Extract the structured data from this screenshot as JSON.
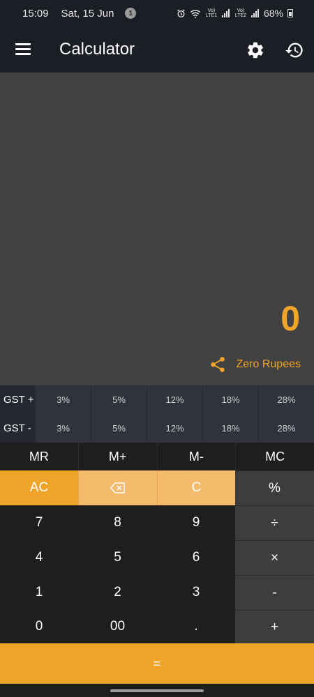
{
  "status_bar": {
    "time": "15:09",
    "date": "Sat, 15 Jun",
    "notification_count": "1",
    "sim1": "Vo) LTE1",
    "sim2": "Vo) LTE2",
    "battery": "68%",
    "icons": [
      "alarm-icon",
      "wifi-icon",
      "signal-icon",
      "battery-icon"
    ]
  },
  "app_bar": {
    "title": "Calculator",
    "icons": [
      "menu-icon",
      "gear-icon",
      "history-icon"
    ]
  },
  "display": {
    "value": "0",
    "in_words": "Zero Rupees",
    "accent_color": "#f0a42a"
  },
  "gst_plus": {
    "label": "GST +",
    "rates": [
      "3%",
      "5%",
      "12%",
      "18%",
      "28%"
    ]
  },
  "gst_minus": {
    "label": "GST -",
    "rates": [
      "3%",
      "5%",
      "12%",
      "18%",
      "28%"
    ]
  },
  "memory": [
    "MR",
    "M+",
    "M-",
    "MC"
  ],
  "keys": {
    "ac": "AC",
    "backspace": "⌫",
    "clear": "C",
    "percent": "%",
    "seven": "7",
    "eight": "8",
    "nine": "9",
    "divide": "÷",
    "four": "4",
    "five": "5",
    "six": "6",
    "multiply": "×",
    "one": "1",
    "two": "2",
    "three": "3",
    "minus": "-",
    "zero": "0",
    "double_zero": "00",
    "dot": ".",
    "plus": "+",
    "equals": "="
  }
}
